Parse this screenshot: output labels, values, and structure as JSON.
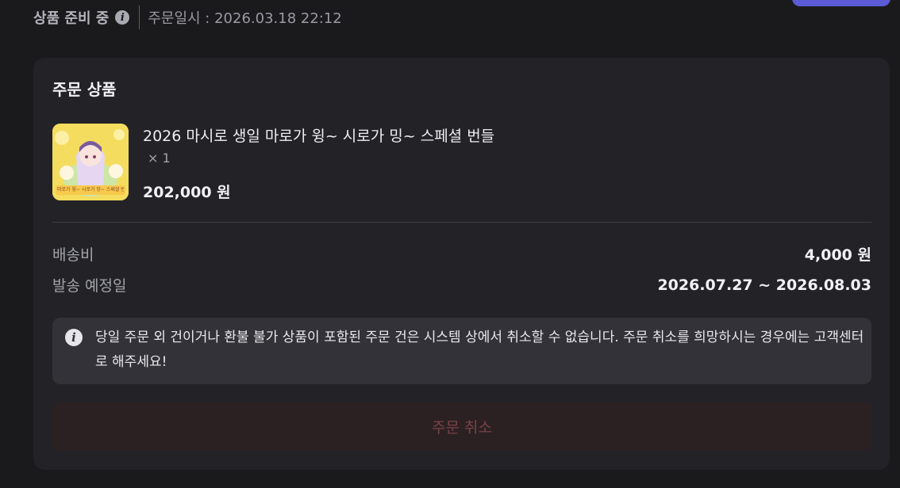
{
  "status": {
    "label": "상품 준비 중",
    "info_icon": "info-icon",
    "order_date": "주문일시 : 2026.03.18 22:12"
  },
  "card": {
    "title": "주문 상품",
    "product": {
      "name": "2026 마시로 생일 마로가 윙~ 시로가 밍~ 스페셜 번들",
      "quantity": "× 1",
      "price": "202,000 원",
      "thumbnail_caption": "마로가 윙~ 시로가 밍~ 스페셜 번들"
    },
    "shipping": {
      "label": "배송비",
      "value": "4,000 원"
    },
    "ship_date": {
      "label": "발송 예정일",
      "value": "2026.07.27 ~ 2026.08.03"
    },
    "notice": {
      "icon": "info-icon",
      "text": "당일 주문 외 건이거나 환불 불가 상품이 포함된 주문 건은 시스템 상에서 취소할 수 없습니다. 주문 취소를 희망하시는 경우에는 고객센터로 해주세요!"
    },
    "cancel_label": "주문 취소"
  },
  "colors": {
    "background": "#1a1a1c",
    "card": "#232327",
    "notice_bg": "#323238",
    "accent_button": "#5b5bd6",
    "cancel_bg": "#2b2123",
    "cancel_text": "#7a4246"
  }
}
